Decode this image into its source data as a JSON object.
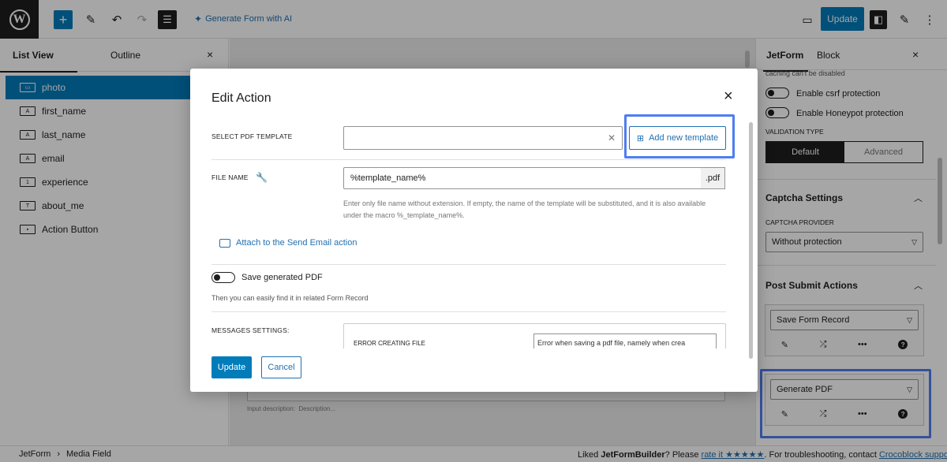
{
  "topbar": {
    "wp_logo": "W",
    "add_icon": "+",
    "generate_ai": "Generate Form with AI",
    "update": "Update"
  },
  "left_panel": {
    "tab_list": "List View",
    "tab_outline": "Outline",
    "close": "×",
    "items": [
      {
        "label": "photo",
        "icon": "media-field-icon"
      },
      {
        "label": "first_name",
        "icon": "text-field-icon"
      },
      {
        "label": "last_name",
        "icon": "text-field-icon"
      },
      {
        "label": "email",
        "icon": "text-field-icon"
      },
      {
        "label": "experience",
        "icon": "number-field-icon"
      },
      {
        "label": "about_me",
        "icon": "textarea-field-icon"
      },
      {
        "label": "Action Button",
        "icon": "action-button-icon"
      }
    ]
  },
  "canvas": {
    "desc_label": "Input description:",
    "desc_value": "Description..."
  },
  "right_panel": {
    "tab_jetform": "JetForm",
    "tab_block": "Block",
    "close": "×",
    "cache_note": "caching can't be disabled",
    "csrf_label": "Enable csrf protection",
    "honeypot_label": "Enable Honeypot protection",
    "validation_type_label": "VALIDATION TYPE",
    "validation_default": "Default",
    "validation_advanced": "Advanced",
    "captcha_section": "Captcha Settings",
    "captcha_provider_label": "CAPTCHA PROVIDER",
    "captcha_provider_value": "Without protection",
    "post_submit_section": "Post Submit Actions",
    "action_1": "Save Form Record",
    "action_2": "Generate PDF"
  },
  "modal": {
    "title": "Edit Action",
    "close": "×",
    "select_template_label": "SELECT PDF TEMPLATE",
    "select_template_value": "",
    "add_template": "Add new template",
    "file_name_label": "FILE NAME",
    "file_name_value": "%template_name%",
    "file_ext": ".pdf",
    "file_help": "Enter only file name without extension. If empty, the name of the template will be substituted, and it is also available under the macro %_template_name%.",
    "attach_link": "Attach to the Send Email action",
    "save_pdf_label": "Save generated PDF",
    "save_pdf_help": "Then you can easily find it in related Form Record",
    "messages_label": "MESSAGES SETTINGS:",
    "error_creating_label": "ERROR CREATING FILE",
    "error_creating_value": "Error when saving a pdf file, namely when crea",
    "update": "Update",
    "cancel": "Cancel"
  },
  "footer": {
    "crumb_1": "JetForm",
    "crumb_sep": "›",
    "crumb_2": "Media Field",
    "liked_pre": "Liked ",
    "liked_brand": "JetFormBuilder",
    "liked_mid": "? Please ",
    "rate_link": "rate it ★★★★★",
    "liked_post": ". For troubleshooting, contact ",
    "support_link": "Crocoblock support"
  },
  "colors": {
    "accent": "#007cba",
    "highlight": "#4f7df0",
    "dark": "#1e1e1e"
  }
}
